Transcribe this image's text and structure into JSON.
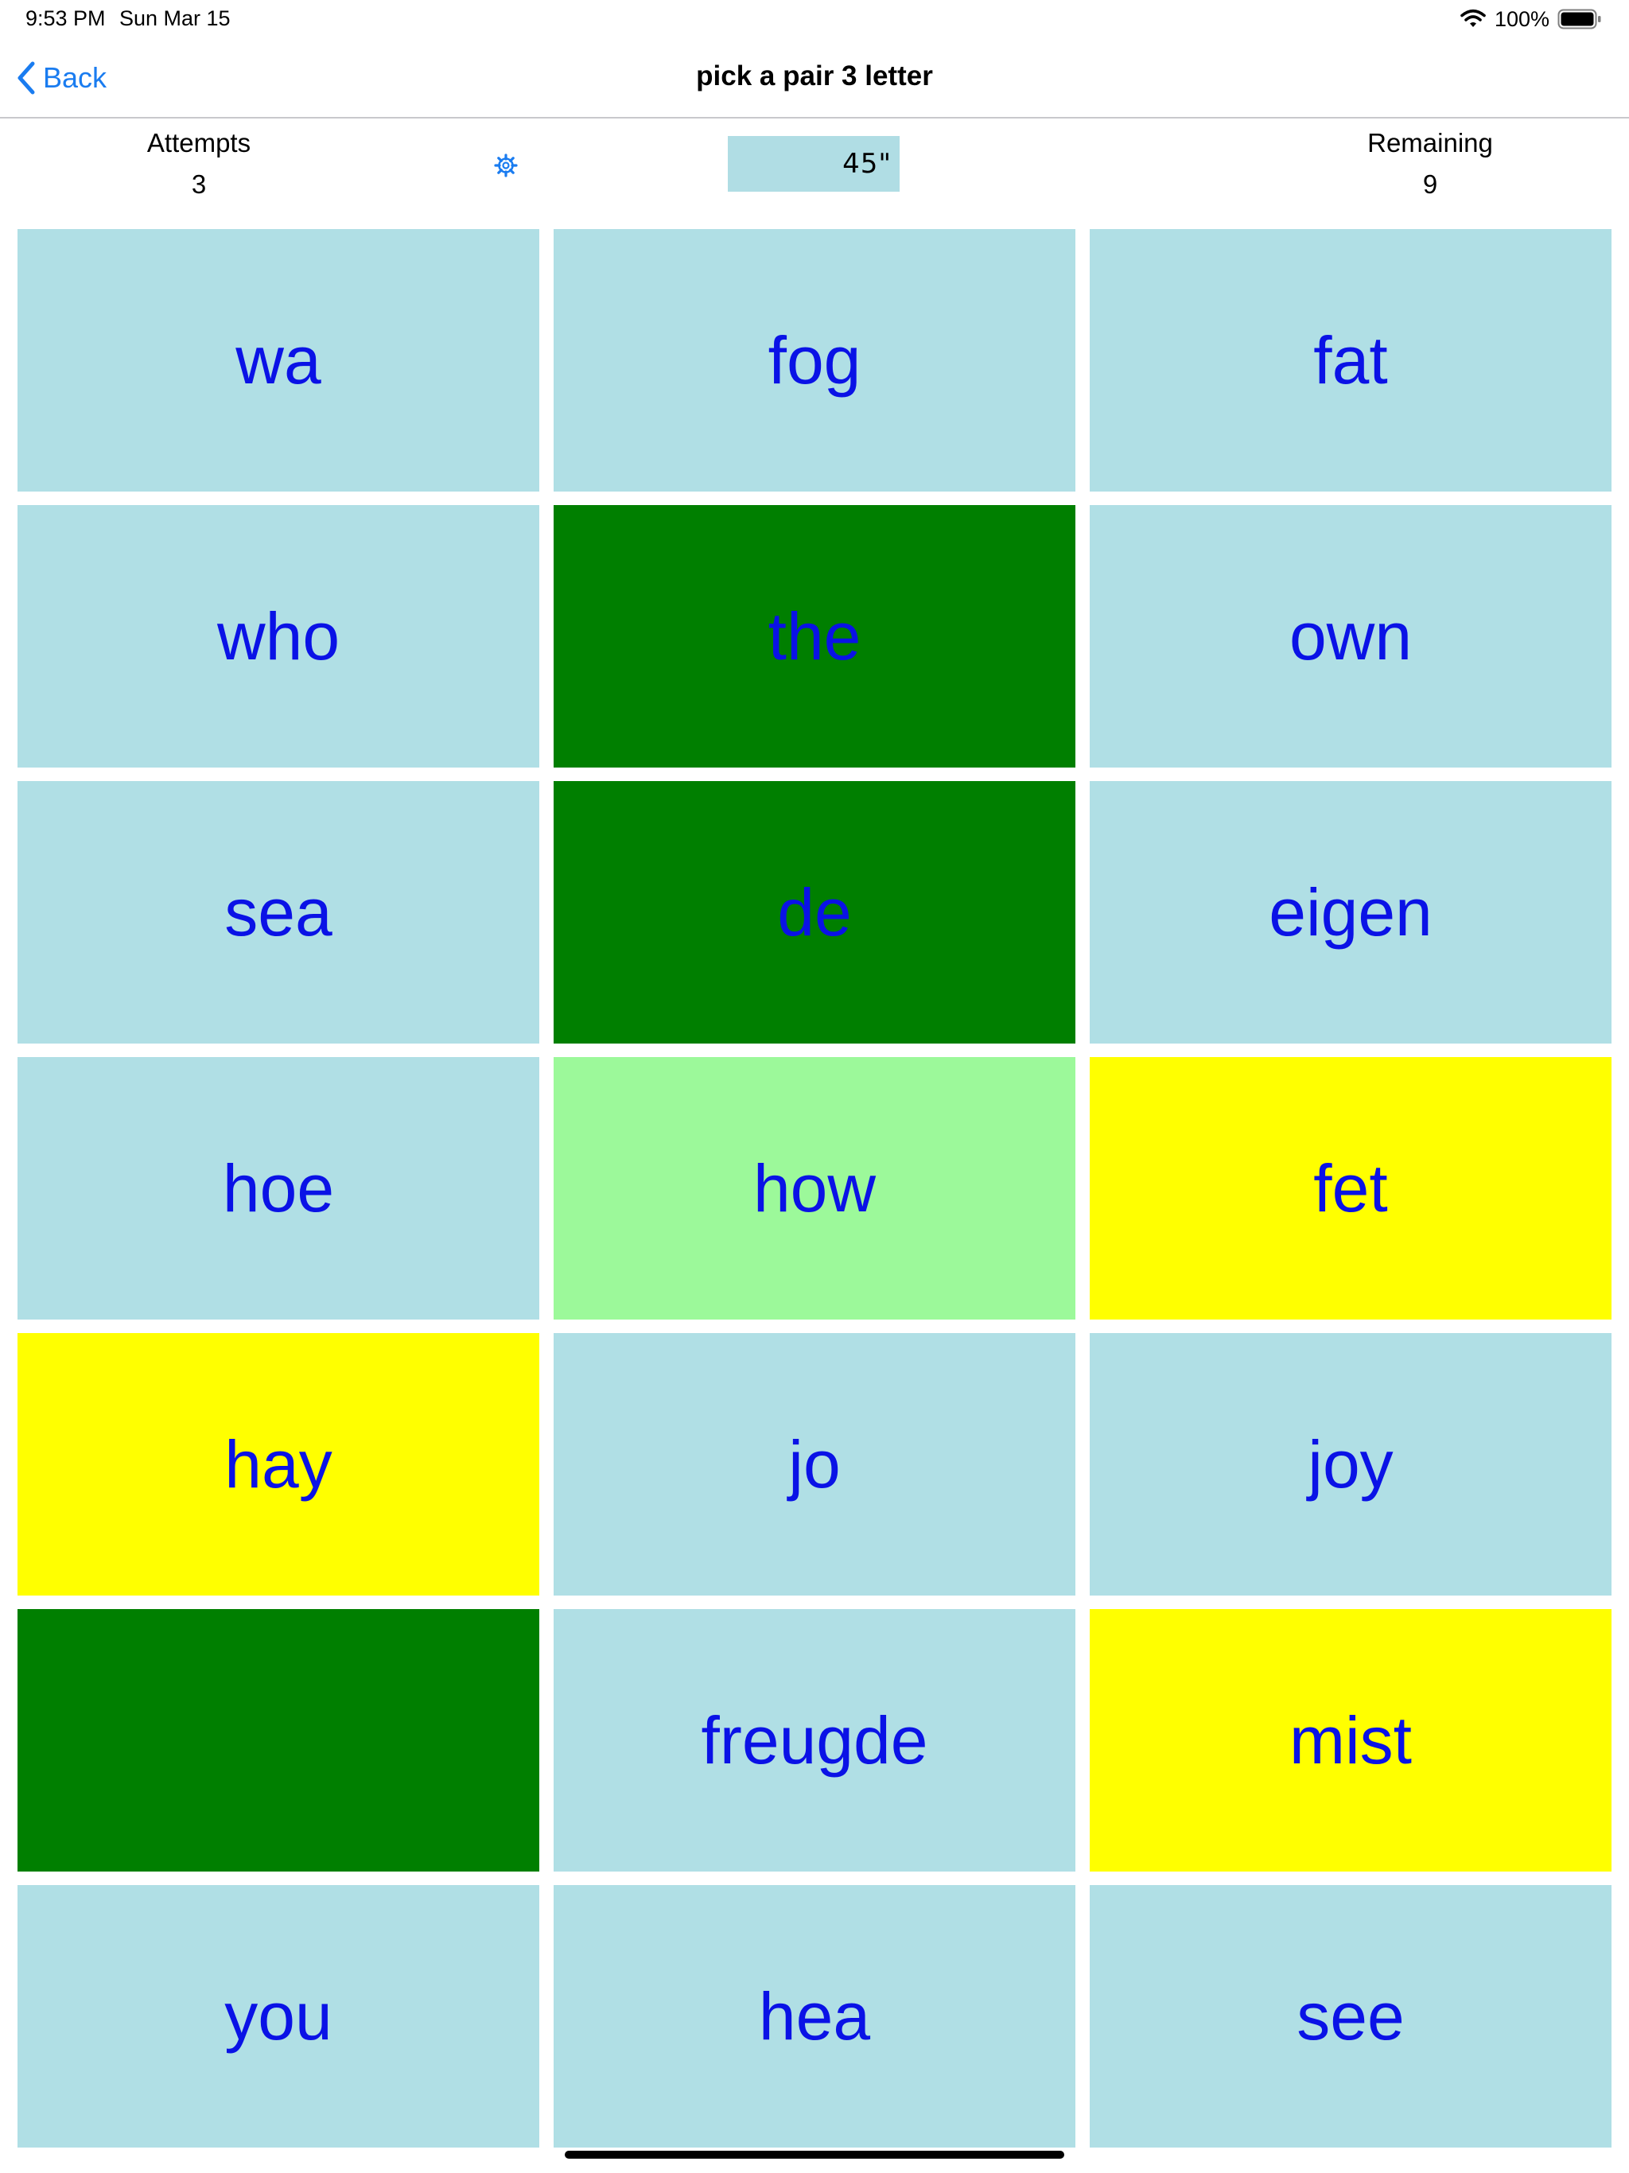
{
  "status_bar": {
    "time": "9:53 PM",
    "date": "Sun Mar 15",
    "battery": "100%",
    "icons": [
      "wifi-icon",
      "battery-icon"
    ]
  },
  "nav": {
    "back_label": "Back",
    "title": "pick a pair 3 letter",
    "back_icon": "chevron-left-icon"
  },
  "stats": {
    "attempts_label": "Attempts",
    "attempts_value": "3",
    "timer": "45\"",
    "remaining_label": "Remaining",
    "remaining_value": "9",
    "settings_icon": "gear-icon"
  },
  "colors": {
    "tile_default": "#b0dfe5",
    "tile_matched": "#007f00",
    "tile_selected": "#9cf99a",
    "tile_highlight": "#ffff00",
    "text": "#0a12e6",
    "accent": "#1a7cf0",
    "timer_bg": "#b0dde4"
  },
  "tiles": [
    {
      "text": "wa",
      "state": "default"
    },
    {
      "text": "fog",
      "state": "default"
    },
    {
      "text": "fat",
      "state": "default"
    },
    {
      "text": "who",
      "state": "default"
    },
    {
      "text": "the",
      "state": "matched"
    },
    {
      "text": "own",
      "state": "default"
    },
    {
      "text": "sea",
      "state": "default"
    },
    {
      "text": "de",
      "state": "matched"
    },
    {
      "text": "eigen",
      "state": "default"
    },
    {
      "text": "hoe",
      "state": "default"
    },
    {
      "text": "how",
      "state": "selected"
    },
    {
      "text": "fet",
      "state": "highlight"
    },
    {
      "text": "hay",
      "state": "highlight"
    },
    {
      "text": "jo",
      "state": "default"
    },
    {
      "text": "joy",
      "state": "default"
    },
    {
      "text": "",
      "state": "matched"
    },
    {
      "text": "freugde",
      "state": "default"
    },
    {
      "text": "mist",
      "state": "highlight"
    },
    {
      "text": "you",
      "state": "default"
    },
    {
      "text": "hea",
      "state": "default"
    },
    {
      "text": "see",
      "state": "default"
    }
  ]
}
